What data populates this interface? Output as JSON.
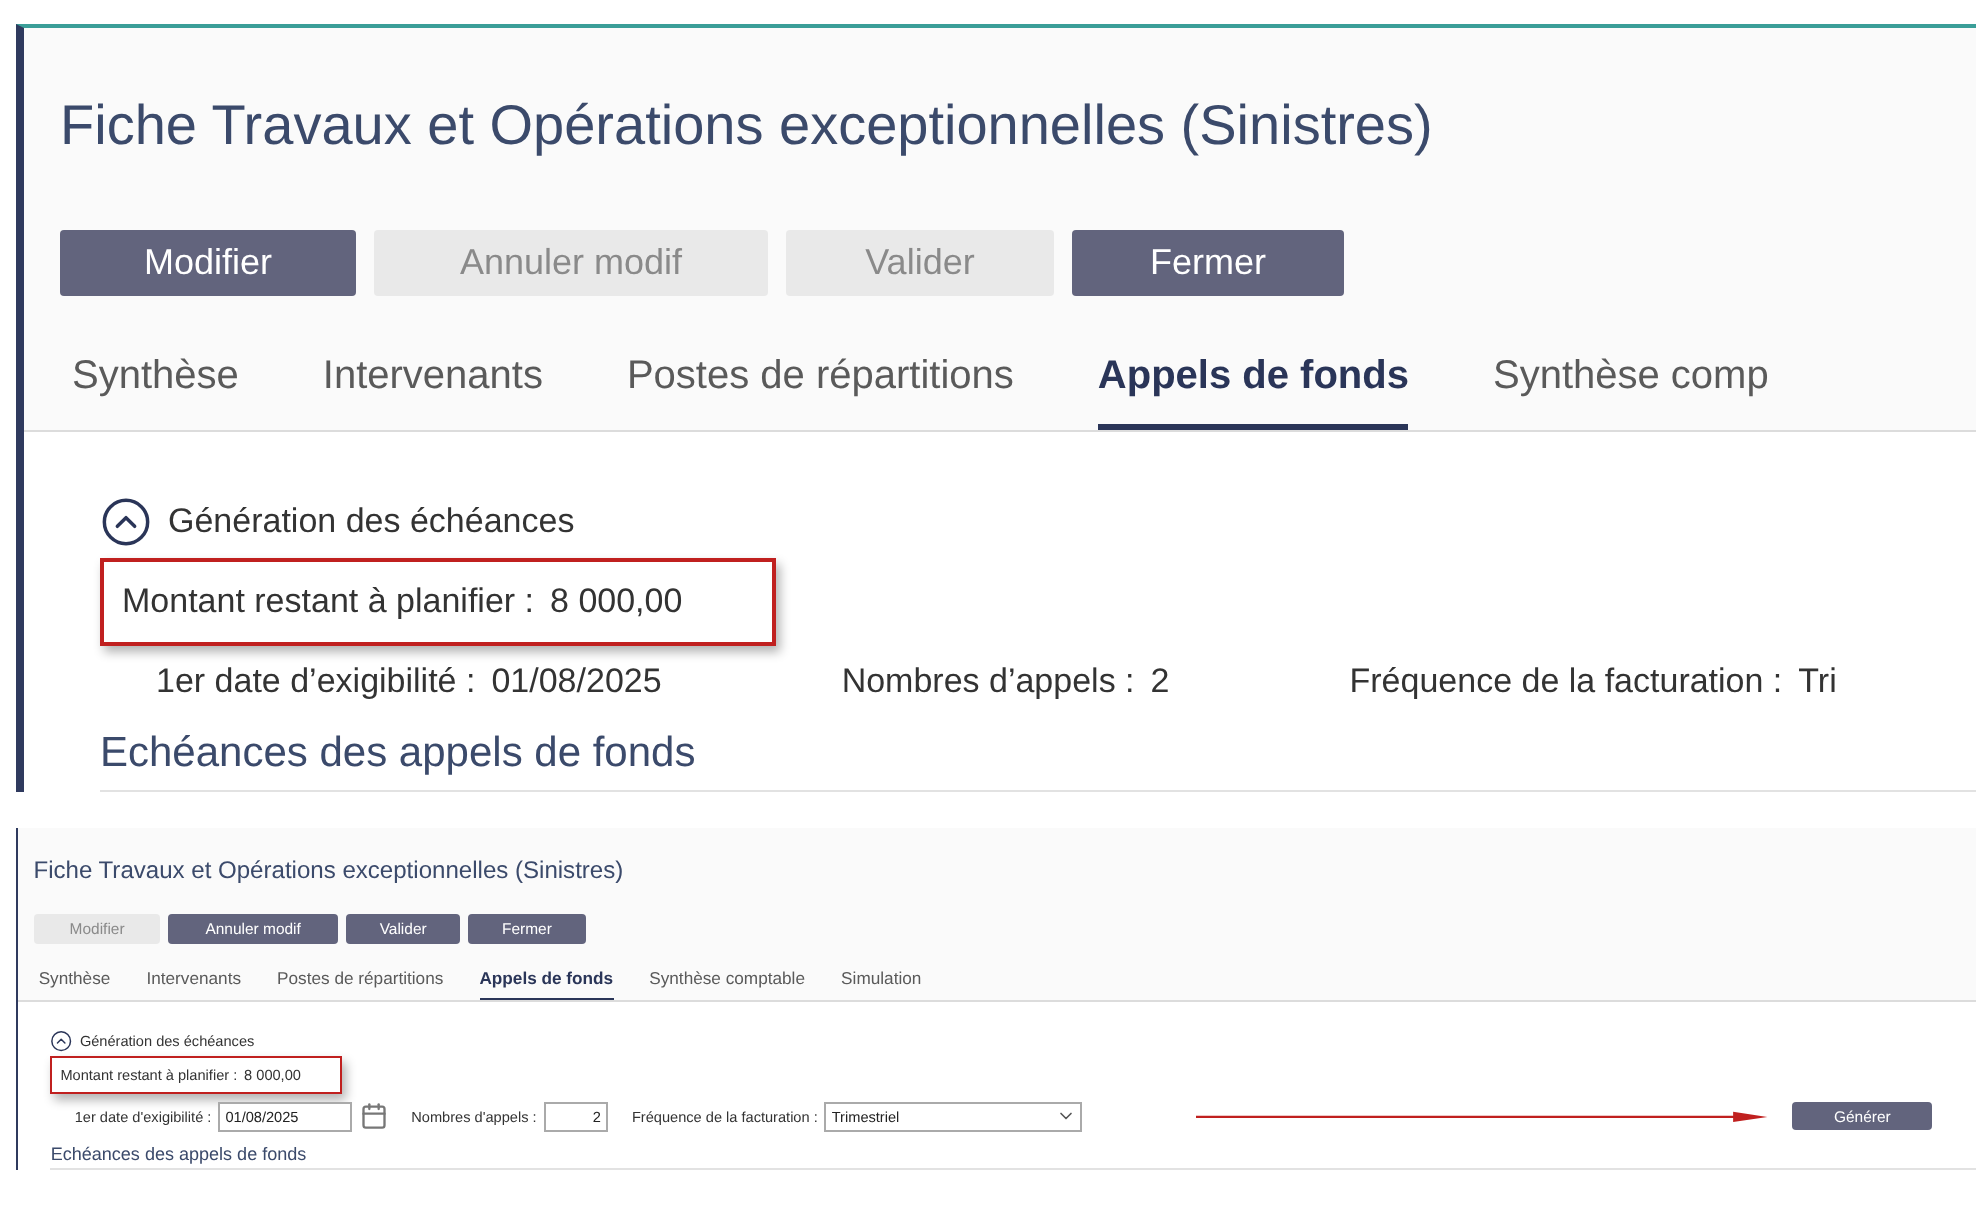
{
  "panels": [
    {
      "title": "Fiche Travaux et Opérations exceptionnelles (Sinistres)",
      "buttons": [
        {
          "label": "Modifier",
          "disabled": false
        },
        {
          "label": "Annuler modif",
          "disabled": true
        },
        {
          "label": "Valider",
          "disabled": true
        },
        {
          "label": "Fermer",
          "disabled": false
        }
      ],
      "tabs": [
        {
          "label": "Synthèse",
          "selected": false
        },
        {
          "label": "Intervenants",
          "selected": false
        },
        {
          "label": "Postes de répartitions",
          "selected": false
        },
        {
          "label": "Appels de fonds",
          "selected": true
        },
        {
          "label": "Synthèse comp",
          "selected": false
        }
      ],
      "section": {
        "label": "Génération des échéances",
        "expanded": true
      },
      "summary": {
        "label": "Montant restant à planifier :",
        "value": "8 000,00",
        "highlighted": true
      },
      "fields": [
        {
          "kind": "text",
          "label": "1er date d’exigibilité :",
          "value": "01/08/2025"
        },
        {
          "kind": "text",
          "label": "Nombres d’appels :",
          "value": "2"
        },
        {
          "kind": "text",
          "label": "Fréquence de la facturation :",
          "value": "Tri"
        }
      ],
      "heading": "Echéances des appels de fonds"
    },
    {
      "title": "Fiche Travaux et Opérations exceptionnelles (Sinistres)",
      "buttons": [
        {
          "label": "Modifier",
          "disabled": true
        },
        {
          "label": "Annuler modif",
          "disabled": false
        },
        {
          "label": "Valider",
          "disabled": false
        },
        {
          "label": "Fermer",
          "disabled": false
        }
      ],
      "tabs": [
        {
          "label": "Synthèse",
          "selected": false
        },
        {
          "label": "Intervenants",
          "selected": false
        },
        {
          "label": "Postes de répartitions",
          "selected": false
        },
        {
          "label": "Appels de fonds",
          "selected": true
        },
        {
          "label": "Synthèse comptable",
          "selected": false
        },
        {
          "label": "Simulation",
          "selected": false
        }
      ],
      "section": {
        "label": "Génération des échéances",
        "expanded": true
      },
      "summary": {
        "label": "Montant restant à planifier :",
        "value": "8 000,00",
        "highlighted": true
      },
      "fields": [
        {
          "kind": "date",
          "label": "1er date d'exigibilité :",
          "value": "01/08/2025"
        },
        {
          "kind": "number",
          "label": "Nombres d'appels :",
          "value": "2"
        },
        {
          "kind": "select",
          "label": "Fréquence de la facturation :",
          "value": "Trimestriel"
        }
      ],
      "generate": {
        "label": "Générer",
        "arrow": true
      },
      "heading": "Echéances des appels de fonds"
    }
  ]
}
